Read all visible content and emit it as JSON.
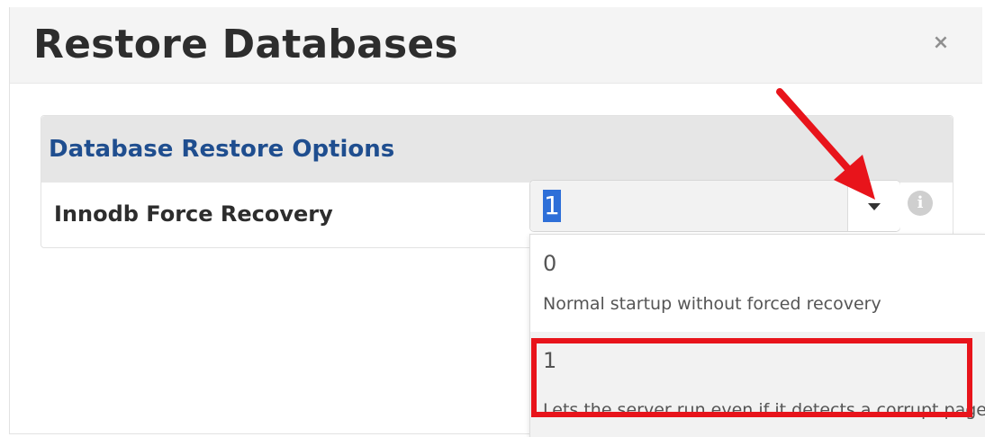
{
  "modal": {
    "title": "Restore Databases",
    "close_label": "×"
  },
  "panel": {
    "title": "Database Restore Options",
    "field_label": "Innodb Force Recovery"
  },
  "select": {
    "value": "1"
  },
  "info": {
    "glyph": "i"
  },
  "dropdown": {
    "options": [
      {
        "value": "0",
        "description": "Normal startup without forced recovery"
      },
      {
        "value": "1",
        "description": "Lets the server run even if it detects a corrupt page"
      }
    ],
    "selected_index": 1
  },
  "annotation": {
    "arrow_color": "#e8141b",
    "highlight_color": "#e8141b"
  }
}
